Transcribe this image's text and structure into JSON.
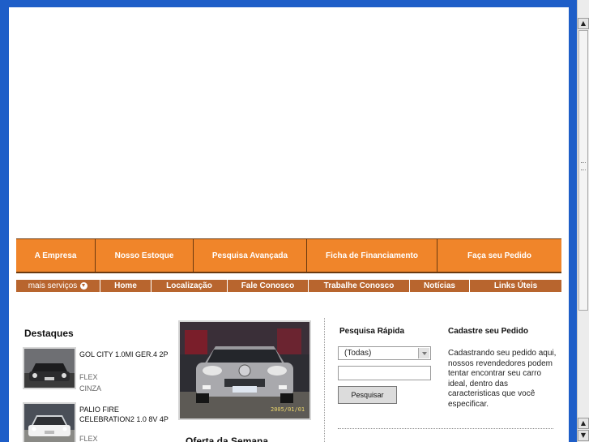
{
  "main_nav": [
    {
      "label": "A Empresa"
    },
    {
      "label": "Nosso Estoque"
    },
    {
      "label": "Pesquisa Avançada"
    },
    {
      "label": "Ficha de Financiamento"
    },
    {
      "label": "Faça seu Pedido"
    }
  ],
  "sub_nav": {
    "more_label": "mais serviços",
    "more_icon": "chevron-down-circle-icon",
    "items": [
      {
        "label": "Home"
      },
      {
        "label": "Localização"
      },
      {
        "label": "Fale Conosco"
      },
      {
        "label": "Trabalhe Conosco"
      },
      {
        "label": "Notícias"
      },
      {
        "label": "Links Úteis"
      }
    ]
  },
  "destaques": {
    "title": "Destaques",
    "items": [
      {
        "name": "GOL CITY 1.0MI GER.4 2P",
        "fuel": "FLEX",
        "color": "CINZA"
      },
      {
        "name": "PALIO FIRE CELEBRATION2 1.0 8V 4P",
        "fuel": "FLEX",
        "color": ""
      }
    ]
  },
  "featured": {
    "photo_date": "2005/01/01",
    "caption": "Oferta da Semana"
  },
  "quick_search": {
    "title": "Pesquisa Rápida",
    "select_value": "(Todas)",
    "text_value": "",
    "button_label": "Pesquisar"
  },
  "cadastre": {
    "title": "Cadastre seu Pedido",
    "text": "Cadastrando seu pedido aqui, nossos revendedores podem tentar encontrar seu carro ideal, dentro das caracteristicas que você especificar."
  },
  "colors": {
    "frame": "#1e5ec8",
    "main_nav_bg": "#f0852a",
    "sub_nav_bg": "#b8652e",
    "nav_border": "#6b3a10"
  }
}
